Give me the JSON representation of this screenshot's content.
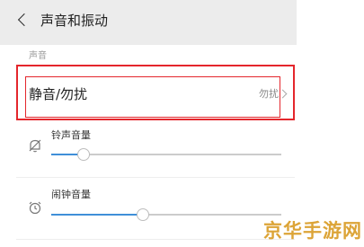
{
  "header": {
    "title": "声音和振动",
    "back_icon": "chevron-left-icon"
  },
  "sections": {
    "sound_header": "声音"
  },
  "settings": {
    "do_not_disturb": {
      "label": "静音/勿扰",
      "value": "勿扰",
      "chevron_icon": "chevron-right-icon"
    },
    "ringer_volume": {
      "label": "铃声音量",
      "icon": "bell-muted-icon",
      "level": 0.14
    },
    "alarm_volume": {
      "label": "闹钟音量",
      "icon": "alarm-clock-icon",
      "level": 0.4
    }
  },
  "watermark": {
    "text": "京华手游网",
    "color": "#dca437"
  },
  "colors": {
    "highlight_border": "#e4262c",
    "slider_fill": "#3f8fd8"
  }
}
